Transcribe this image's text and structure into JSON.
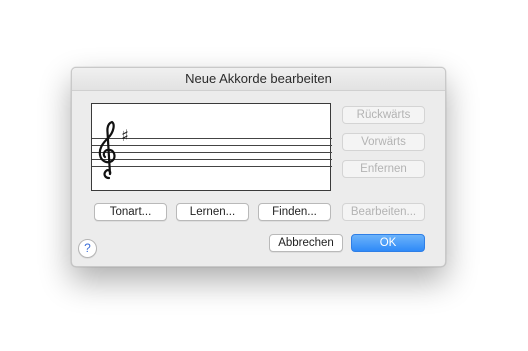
{
  "dialog": {
    "title": "Neue Akkorde bearbeiten"
  },
  "staff": {
    "clef": "treble-clef-icon",
    "key_signature": "♯"
  },
  "side_buttons": {
    "back_label": "Rückwärts",
    "forward_label": "Vorwärts",
    "remove_label": "Enfernen"
  },
  "action_buttons": {
    "key_label": "Tonart...",
    "learn_label": "Lernen...",
    "find_label": "Finden...",
    "edit_label": "Bearbeiten..."
  },
  "footer": {
    "help_label": "?",
    "cancel_label": "Abbrechen",
    "ok_label": "OK"
  },
  "colors": {
    "accent": "#2f8af8",
    "dialog_bg": "#ececec",
    "disabled_text": "#b3b3b3"
  }
}
